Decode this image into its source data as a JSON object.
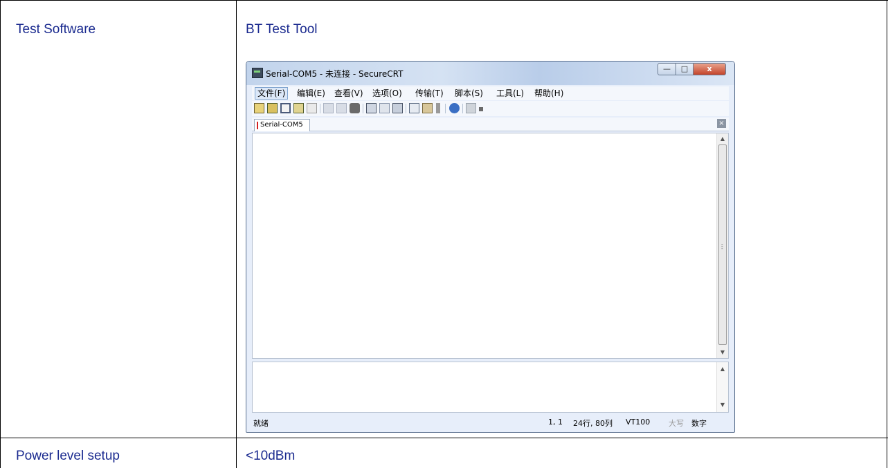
{
  "table": {
    "rows": [
      {
        "label": "Test Software",
        "value": "BT Test Tool"
      },
      {
        "label": "Power level setup",
        "value": "<10dBm"
      }
    ]
  },
  "app_window": {
    "title": "Serial-COM5 - 未连接 - SecureCRT",
    "title_buttons": {
      "minimize": "—",
      "maximize": "□",
      "close": "x"
    },
    "menu": [
      {
        "label": "文件(F)",
        "active": true
      },
      {
        "label": "编辑(E)"
      },
      {
        "label": "查看(V)"
      },
      {
        "label": "选项(O)"
      },
      {
        "label": "传输(T)"
      },
      {
        "label": "脚本(S)"
      },
      {
        "label": "工具(L)"
      },
      {
        "label": "帮助(H)"
      }
    ],
    "toolbar_icons": [
      "connect-icon",
      "quick-connect-icon",
      "connect-tab-icon",
      "reconnect-icon",
      "disconnect-icon",
      "copy-icon",
      "paste-icon",
      "find-icon",
      "print-setup-icon",
      "print-selection-icon",
      "print-icon",
      "session-options-icon",
      "global-options-icon",
      "keymap-icon",
      "help-icon",
      "sftp-icon",
      "more-icon"
    ],
    "tab": {
      "label": "Serial-COM5",
      "close": "×"
    },
    "status": {
      "ready": "就绪",
      "cursor": "1,   1",
      "size": "24行, 80列",
      "terminal": "VT100",
      "caps": "大写",
      "num": "数字"
    },
    "colors": {
      "titlebar": "#c2d4ec",
      "frame": "#e7eefa",
      "close_button": "#c3442a",
      "text_blue": "#1a2a8f"
    }
  }
}
